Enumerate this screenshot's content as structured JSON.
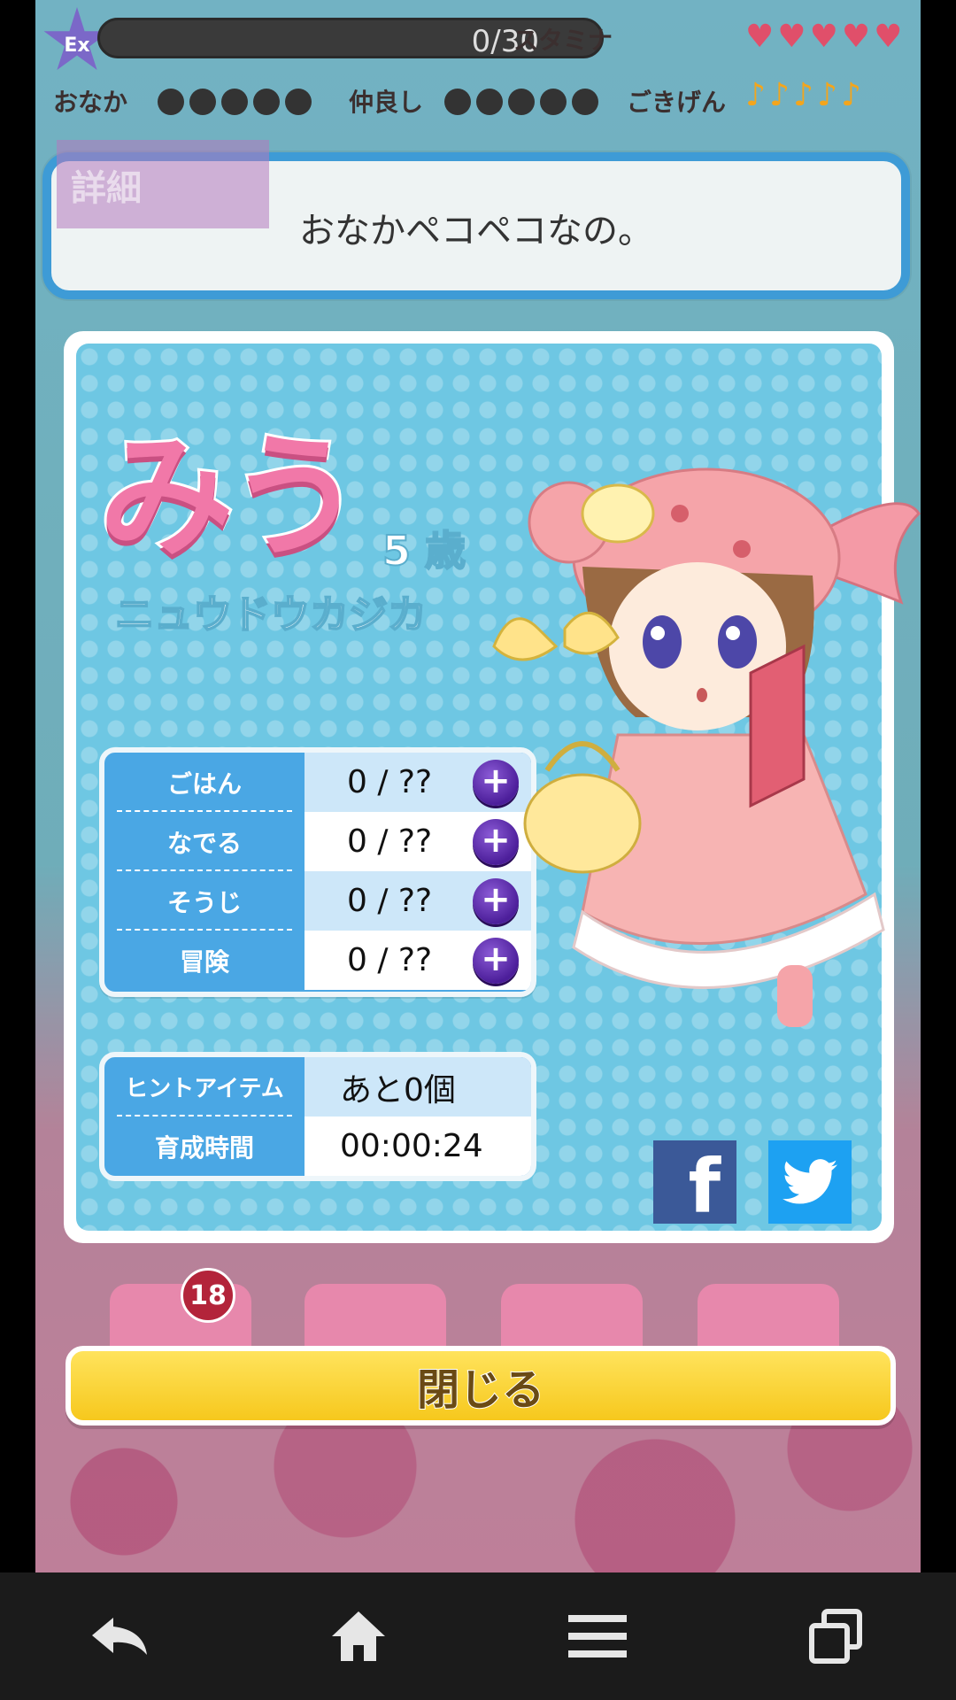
{
  "hud": {
    "level_badge": "Ex",
    "exp_text": "0/30",
    "stamina_label": "スタミナ",
    "hunger_label": "おなか",
    "friendship_label": "仲良し",
    "mood_label": "ごきげん",
    "stamina_hearts": 5,
    "hunger_dots": 5,
    "friend_dots": 5,
    "mood_notes": 5
  },
  "speech": {
    "tab_label": "詳細",
    "text": "おなかペコペコなの。"
  },
  "profile": {
    "name": "みう",
    "age": "5 歳",
    "species": "ニュウドウカジカ"
  },
  "stats": [
    {
      "label": "ごはん",
      "value": "0 / ??"
    },
    {
      "label": "なでる",
      "value": "0 / ??"
    },
    {
      "label": "そうじ",
      "value": "0 / ??"
    },
    {
      "label": "冒険",
      "value": "0 / ??"
    }
  ],
  "info": [
    {
      "label": "ヒントアイテム",
      "value": "あと0個"
    },
    {
      "label": "育成時間",
      "value": "00:00:24"
    }
  ],
  "social": {
    "facebook_glyph": "f"
  },
  "notification_badge": "18",
  "close_label": "閉じる",
  "colors": {
    "name_pink": "#f178a8",
    "card_blue": "#6ec7e3",
    "table_blue": "#4aa7e4",
    "close_yellow": "#f6c81d",
    "facebook": "#3b5998",
    "twitter": "#1da1f2"
  }
}
